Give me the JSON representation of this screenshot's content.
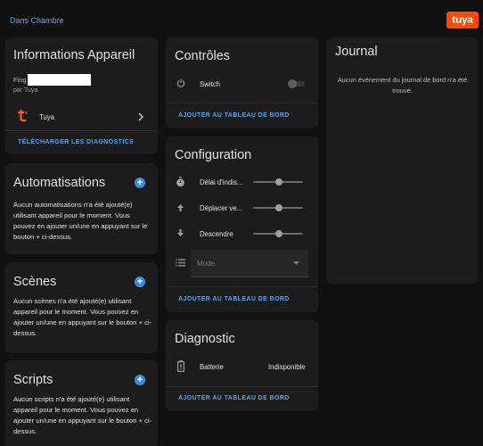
{
  "breadcrumb": "Dans Chambre",
  "logo_text": "tuya",
  "device_info": {
    "title": "Informations Appareil",
    "name_prefix": "Fing",
    "by_line": "par Tuya",
    "integration": "Tuya",
    "download_link": "TÉLÉCHARGER LES DIAGNOSTICS"
  },
  "automations": {
    "title": "Automatisations",
    "text": "Aucun automatisations n'a été ajouté(e) utilisant appareil pour le moment. Vous pouvez en ajouter un/une en appuyant sur le bouton + ci-dessus."
  },
  "scenes": {
    "title": "Scènes",
    "text": "Aucun scènes n'a été ajouté(e) utilisant appareil pour le moment. Vous pouvez en ajouter un/une en appuyant sur le bouton + ci-dessus."
  },
  "scripts": {
    "title": "Scripts",
    "text": "Aucun scripts n'a été ajouté(e) utilisant appareil pour le moment. Vous pouvez en ajouter un/une en appuyant sur le bouton + ci-dessus."
  },
  "controls": {
    "title": "Contrôles",
    "switch_label": "Switch",
    "switch_on": false,
    "add_link": "AJOUTER AU TABLEAU DE BORD"
  },
  "configuration": {
    "title": "Configuration",
    "sliders": [
      {
        "label": "Délai d'indis...",
        "value": 0.5
      },
      {
        "label": "Déplacer ve...",
        "value": 0.5
      },
      {
        "label": "Descendre",
        "value": 0.5
      }
    ],
    "mode_label": "Mode",
    "add_link": "AJOUTER AU TABLEAU DE BORD"
  },
  "diagnostic": {
    "title": "Diagnostic",
    "battery_label": "Batterie",
    "battery_value": "Indisponible",
    "add_link": "AJOUTER AU TABLEAU DE BORD"
  },
  "journal": {
    "title": "Journal",
    "empty_text": "Aucun événement du journal de bord n'a été trouvé."
  },
  "colors": {
    "background": "#111111",
    "card": "#1c1c1c",
    "accent": "#5aa3e6",
    "brand": "#ff4800"
  }
}
